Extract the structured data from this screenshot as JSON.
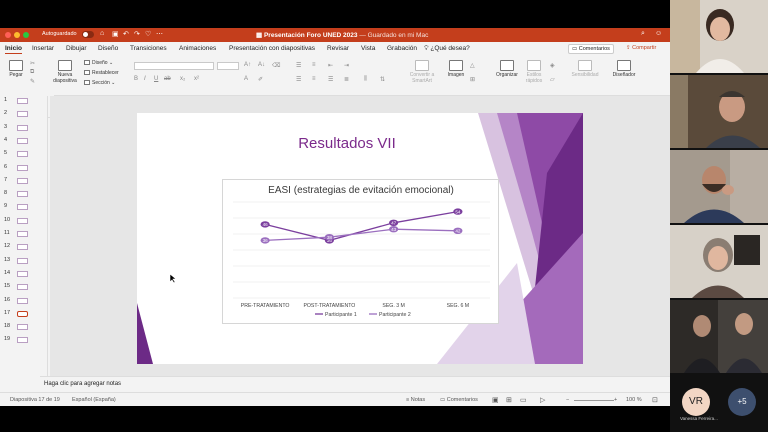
{
  "window": {
    "autosave_label": "Autoguardado",
    "title": "Presentación Foro UNED 2023",
    "saved_status": "— Guardado en mi Mac"
  },
  "menu": {
    "tabs": [
      "Inicio",
      "Insertar",
      "Dibujar",
      "Diseño",
      "Transiciones",
      "Animaciones",
      "Presentación con diapositivas",
      "Revisar",
      "Vista",
      "Grabación"
    ],
    "tell_me": "¿Qué desea?",
    "comments_button": "Comentarios",
    "share_button": "Compartir"
  },
  "ribbon": {
    "paste": "Pegar",
    "new_slide": "Nueva diapositiva",
    "layout": "Diseño",
    "reset": "Restablecer",
    "section": "Sección",
    "convert_smartart": "Convertir a SmartArt",
    "picture": "Imagen",
    "arrange": "Organizar",
    "quick_styles": "Estilos rápidos",
    "sensitivity": "Sensibilidad",
    "designer": "Diseñador"
  },
  "thumbnails": {
    "numbers": [
      "1",
      "2",
      "3",
      "4",
      "5",
      "6",
      "7",
      "8",
      "9",
      "10",
      "11",
      "12",
      "13",
      "14",
      "15",
      "16",
      "17",
      "18",
      "19"
    ],
    "active_index": 17
  },
  "slide": {
    "title": "Resultados VII"
  },
  "chart_data": {
    "type": "line",
    "title": "EASI (estrategias de evitación emocional)",
    "categories": [
      "PRE-TRATAMIENTO",
      "POST-TRATAMIENTO",
      "SEG. 3 M",
      "SEG. 6 M"
    ],
    "series": [
      {
        "name": "Participante 1",
        "values": [
          46,
          36,
          47,
          54
        ],
        "color": "#7b3f9e"
      },
      {
        "name": "Participante 2",
        "values": [
          36,
          38,
          43,
          42
        ],
        "color": "#9b6fbf"
      }
    ],
    "ylim": [
      0,
      60
    ],
    "grid": true,
    "legend": "bottom"
  },
  "notes": {
    "placeholder": "Haga clic para agregar notas"
  },
  "status": {
    "slide_counter": "Diapositiva 17 de 19",
    "language": "Español (España)",
    "notes": "Notas",
    "comments": "Comentarios",
    "zoom": "100 %"
  },
  "participants": {
    "avatar_initials": "VR",
    "avatar_name": "Vanessa Ferreira...",
    "more_count": "+5"
  },
  "colors": {
    "accent": "#c43e1c",
    "slide_purple": "#7b2a8b"
  }
}
